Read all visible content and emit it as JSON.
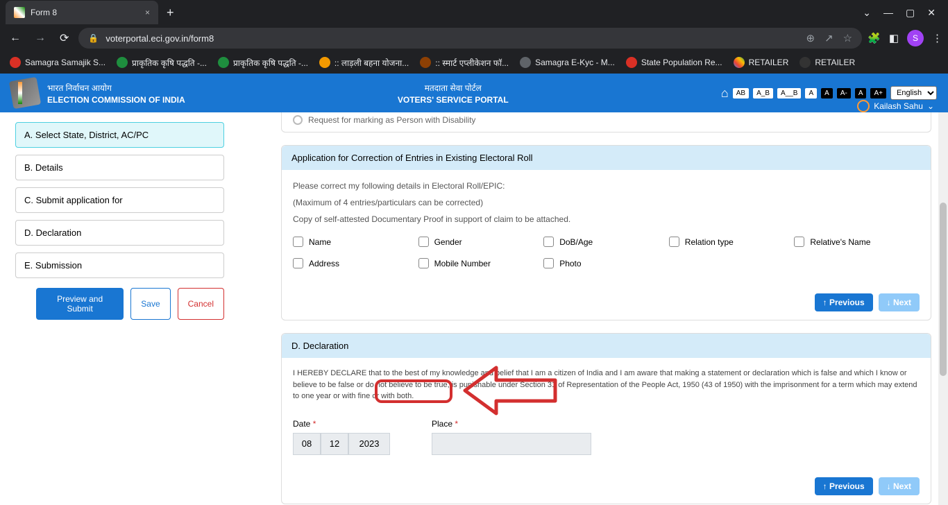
{
  "browser": {
    "tab_title": "Form 8",
    "url": "voterportal.eci.gov.in/form8",
    "profile_letter": "S",
    "bookmarks": [
      {
        "label": "Samagra Samajik S...",
        "color": "bm-red"
      },
      {
        "label": "प्राकृतिक कृषि पद्धति -...",
        "color": "bm-green"
      },
      {
        "label": "प्राकृतिक कृषि पद्धति -...",
        "color": "bm-green"
      },
      {
        "label": ":: लाड़ली बहना योजना...",
        "color": "bm-orange"
      },
      {
        "label": ":: स्मार्ट एप्लीकेशन फॉ...",
        "color": "bm-brown"
      },
      {
        "label": "Samagra E-Kyc - M...",
        "color": "bm-gray"
      },
      {
        "label": "State Population Re...",
        "color": "bm-red"
      },
      {
        "label": "RETAILER",
        "color": "bm-multi"
      },
      {
        "label": "RETAILER",
        "color": "bm-dark"
      }
    ]
  },
  "header": {
    "title_hi": "भारत निर्वाचन आयोग",
    "title_en": "ELECTION COMMISSION OF INDIA",
    "center_hi": "मतदाता सेवा पोर्टल",
    "center_en": "VOTERS' SERVICE PORTAL",
    "lang": "English",
    "user": "Kailash Sahu",
    "theme": [
      "AB",
      "A_B",
      "A__B",
      "A"
    ],
    "sizes": [
      "A-",
      "A",
      "A+"
    ]
  },
  "sidebar": {
    "steps": [
      "A. Select State, District, AC/PC",
      "B. Details",
      "C. Submit application for",
      "D. Declaration",
      "E. Submission"
    ],
    "preview": "Preview and Submit",
    "save": "Save",
    "cancel": "Cancel"
  },
  "radio_option": "Request for marking as Person with Disability",
  "correction": {
    "title": "Application for Correction of Entries in Existing Electoral Roll",
    "line1": "Please correct my following details in Electoral Roll/EPIC:",
    "line2": "(Maximum of 4 entries/particulars can be corrected)",
    "line3": "Copy of self-attested Documentary Proof in support of claim to be attached.",
    "options": [
      "Name",
      "Gender",
      "DoB/Age",
      "Relation type",
      "Relative's Name",
      "Address",
      "Mobile Number",
      "Photo"
    ]
  },
  "nav": {
    "prev": "↑ Previous",
    "next": "↓ Next"
  },
  "declaration": {
    "title": "D. Declaration",
    "text": "I HEREBY DECLARE that to the best of my knowledge and belief that I am a citizen of India and I am aware that making a statement or declaration which is false and which I know or believe to be false or do not believe to be true, is punishable under Section 31 of Representation of the People Act, 1950 (43 of 1950) with the imprisonment for a term which may extend to one year or with fine or with both.",
    "date_label": "Date",
    "place_label": "Place",
    "date": {
      "dd": "08",
      "mm": "12",
      "yyyy": "2023"
    }
  }
}
